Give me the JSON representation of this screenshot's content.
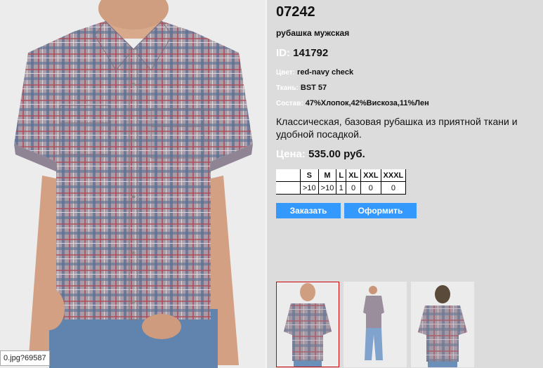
{
  "product": {
    "sku": "07242",
    "name": "рубашка мужская",
    "id_label": "ID:",
    "id_value": "141792",
    "color_label": "Цвет:",
    "color_value": "red-navy check",
    "fabric_label": "Ткань:",
    "fabric_value": "BST 57",
    "composition_label": "Состав:",
    "composition_value": "47%Хлопок,42%Вискоза,11%Лен",
    "description": "Классическая, базовая рубашка из приятной ткани и удобной посадкой.",
    "price_label": "Цена:",
    "price_value": "535.00 руб."
  },
  "sizes": {
    "headers": [
      "S",
      "M",
      "L",
      "XL",
      "XXL",
      "XXXL"
    ],
    "stock": [
      ">10",
      ">10",
      "1",
      "0",
      "0",
      "0"
    ]
  },
  "buttons": {
    "order": "Заказать",
    "checkout": "Оформить"
  },
  "status_tooltip": "0.jpg?69587",
  "colors": {
    "accent_button": "#3399ff",
    "active_thumb_border": "#cc0000",
    "page_background": "#dcdcdc"
  },
  "thumbnails": [
    {
      "view": "front-closeup",
      "active": true
    },
    {
      "view": "full-body-front",
      "active": false
    },
    {
      "view": "back",
      "active": false
    }
  ]
}
